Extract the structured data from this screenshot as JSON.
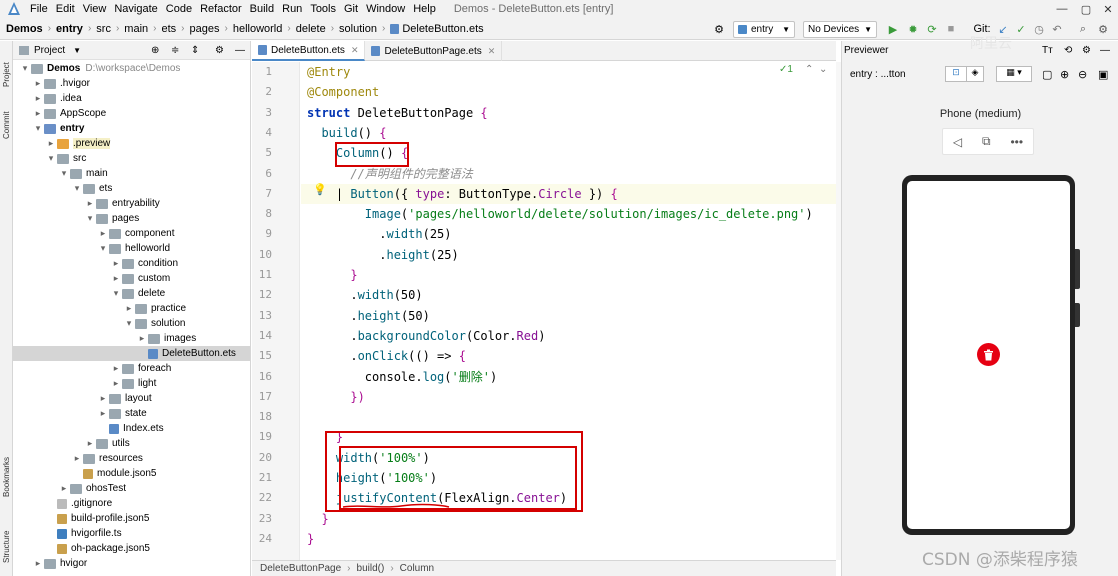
{
  "menu": {
    "items": [
      "File",
      "Edit",
      "View",
      "Navigate",
      "Code",
      "Refactor",
      "Build",
      "Run",
      "Tools",
      "Git",
      "Window",
      "Help"
    ],
    "window_title": "Demos - DeleteButton.ets [entry]"
  },
  "breadcrumbs": [
    "Demos",
    "entry",
    "src",
    "main",
    "ets",
    "pages",
    "helloworld",
    "delete",
    "solution",
    "DeleteButton.ets"
  ],
  "toolbar": {
    "run_config": "entry",
    "device": "No Devices",
    "git_label": "Git:"
  },
  "sidebar_tabs": [
    "Project",
    "Commit",
    "Bookmarks",
    "Structure"
  ],
  "project": {
    "title": "Project",
    "tree": [
      {
        "label": "Demos",
        "path": "D:\\workspace\\Demos",
        "depth": 0,
        "arrow": "▾",
        "icon": "folder",
        "bold": true
      },
      {
        "label": ".hvigor",
        "depth": 1,
        "arrow": "▸",
        "icon": "folder"
      },
      {
        "label": ".idea",
        "depth": 1,
        "arrow": "▸",
        "icon": "folder"
      },
      {
        "label": "AppScope",
        "depth": 1,
        "arrow": "▸",
        "icon": "folder"
      },
      {
        "label": "entry",
        "depth": 1,
        "arrow": "▾",
        "icon": "folder-blue",
        "bold": true
      },
      {
        "label": ".preview",
        "depth": 2,
        "arrow": "▸",
        "icon": "folder-orange",
        "highlight": true
      },
      {
        "label": "src",
        "depth": 2,
        "arrow": "▾",
        "icon": "folder"
      },
      {
        "label": "main",
        "depth": 3,
        "arrow": "▾",
        "icon": "folder"
      },
      {
        "label": "ets",
        "depth": 4,
        "arrow": "▾",
        "icon": "folder"
      },
      {
        "label": "entryability",
        "depth": 5,
        "arrow": "▸",
        "icon": "folder"
      },
      {
        "label": "pages",
        "depth": 5,
        "arrow": "▾",
        "icon": "folder"
      },
      {
        "label": "component",
        "depth": 6,
        "arrow": "▸",
        "icon": "folder"
      },
      {
        "label": "helloworld",
        "depth": 6,
        "arrow": "▾",
        "icon": "folder"
      },
      {
        "label": "condition",
        "depth": 7,
        "arrow": "▸",
        "icon": "folder"
      },
      {
        "label": "custom",
        "depth": 7,
        "arrow": "▸",
        "icon": "folder"
      },
      {
        "label": "delete",
        "depth": 7,
        "arrow": "▾",
        "icon": "folder"
      },
      {
        "label": "practice",
        "depth": 8,
        "arrow": "▸",
        "icon": "folder"
      },
      {
        "label": "solution",
        "depth": 8,
        "arrow": "▾",
        "icon": "folder"
      },
      {
        "label": "images",
        "depth": 9,
        "arrow": "▸",
        "icon": "folder"
      },
      {
        "label": "DeleteButton.ets",
        "depth": 9,
        "arrow": "",
        "icon": "ets",
        "selected": true
      },
      {
        "label": "foreach",
        "depth": 7,
        "arrow": "▸",
        "icon": "folder"
      },
      {
        "label": "light",
        "depth": 7,
        "arrow": "▸",
        "icon": "folder"
      },
      {
        "label": "layout",
        "depth": 6,
        "arrow": "▸",
        "icon": "folder"
      },
      {
        "label": "state",
        "depth": 6,
        "arrow": "▸",
        "icon": "folder"
      },
      {
        "label": "Index.ets",
        "depth": 6,
        "arrow": "",
        "icon": "ets"
      },
      {
        "label": "utils",
        "depth": 5,
        "arrow": "▸",
        "icon": "folder"
      },
      {
        "label": "resources",
        "depth": 4,
        "arrow": "▸",
        "icon": "folder"
      },
      {
        "label": "module.json5",
        "depth": 4,
        "arrow": "",
        "icon": "json"
      },
      {
        "label": "ohosTest",
        "depth": 3,
        "arrow": "▸",
        "icon": "folder"
      },
      {
        "label": ".gitignore",
        "depth": 2,
        "arrow": "",
        "icon": "git"
      },
      {
        "label": "build-profile.json5",
        "depth": 2,
        "arrow": "",
        "icon": "json"
      },
      {
        "label": "hvigorfile.ts",
        "depth": 2,
        "arrow": "",
        "icon": "ts"
      },
      {
        "label": "oh-package.json5",
        "depth": 2,
        "arrow": "",
        "icon": "json"
      },
      {
        "label": "hvigor",
        "depth": 1,
        "arrow": "▸",
        "icon": "folder"
      }
    ]
  },
  "editor": {
    "tabs": [
      {
        "label": "DeleteButton.ets",
        "active": true
      },
      {
        "label": "DeleteButtonPage.ets",
        "active": false
      }
    ],
    "inspection": "✓1",
    "line_numbers": [
      "1",
      "2",
      "3",
      "4",
      "5",
      "6",
      "7",
      "8",
      "9",
      "10",
      "11",
      "12",
      "13",
      "14",
      "15",
      "16",
      "17",
      "18",
      "19",
      "20",
      "21",
      "22",
      "23",
      "24"
    ],
    "code_lines": [
      [
        [
          "ann",
          "@Entry"
        ]
      ],
      [
        [
          "ann",
          "@Component"
        ]
      ],
      [
        [
          "kw",
          "struct "
        ],
        [
          "typ",
          "DeleteButtonPage "
        ],
        [
          "brk",
          "{"
        ]
      ],
      [
        [
          "typ",
          "  "
        ],
        [
          "fn",
          "build"
        ],
        [
          "typ",
          "() "
        ],
        [
          "brk",
          "{"
        ]
      ],
      [
        [
          "typ",
          "    "
        ],
        [
          "fn",
          "Column"
        ],
        [
          "typ",
          "() "
        ],
        [
          "brk",
          "{"
        ]
      ],
      [
        [
          "typ",
          "      "
        ],
        [
          "cmt",
          "//声明组件的完整语法"
        ]
      ],
      [
        [
          "typ",
          "    | "
        ],
        [
          "fn",
          "Button"
        ],
        [
          "typ",
          "({ "
        ],
        [
          "prop",
          "type"
        ],
        [
          "typ",
          ": ButtonType."
        ],
        [
          "prop",
          "Circle"
        ],
        [
          "typ",
          " }) "
        ],
        [
          "brk",
          "{"
        ]
      ],
      [
        [
          "typ",
          "        "
        ],
        [
          "fn",
          "Image"
        ],
        [
          "typ",
          "("
        ],
        [
          "str",
          "'pages/helloworld/delete/solution/images/ic_delete.png'"
        ],
        [
          "typ",
          ")"
        ]
      ],
      [
        [
          "typ",
          "          ."
        ],
        [
          "fn",
          "width"
        ],
        [
          "typ",
          "(25)"
        ]
      ],
      [
        [
          "typ",
          "          ."
        ],
        [
          "fn",
          "height"
        ],
        [
          "typ",
          "(25)"
        ]
      ],
      [
        [
          "typ",
          "      "
        ],
        [
          "brk",
          "}"
        ]
      ],
      [
        [
          "typ",
          "      ."
        ],
        [
          "fn",
          "width"
        ],
        [
          "typ",
          "(50)"
        ]
      ],
      [
        [
          "typ",
          "      ."
        ],
        [
          "fn",
          "height"
        ],
        [
          "typ",
          "(50)"
        ]
      ],
      [
        [
          "typ",
          "      ."
        ],
        [
          "fn",
          "backgroundColor"
        ],
        [
          "typ",
          "(Color."
        ],
        [
          "prop",
          "Red"
        ],
        [
          "typ",
          ")"
        ]
      ],
      [
        [
          "typ",
          "      ."
        ],
        [
          "fn",
          "onClick"
        ],
        [
          "typ",
          "(() => "
        ],
        [
          "brk",
          "{"
        ]
      ],
      [
        [
          "typ",
          "        console."
        ],
        [
          "fn",
          "log"
        ],
        [
          "typ",
          "("
        ],
        [
          "str",
          "'删除'"
        ],
        [
          "typ",
          ")"
        ]
      ],
      [
        [
          "typ",
          "      "
        ],
        [
          "brk",
          "})"
        ]
      ],
      [
        [
          "typ",
          ""
        ]
      ],
      [
        [
          "typ",
          "    "
        ],
        [
          "brk",
          "}"
        ]
      ],
      [
        [
          "typ",
          "    "
        ],
        [
          "fn",
          "width"
        ],
        [
          "typ",
          "("
        ],
        [
          "str",
          "'100%'"
        ],
        [
          "typ",
          ")"
        ]
      ],
      [
        [
          "typ",
          "    "
        ],
        [
          "fn",
          "height"
        ],
        [
          "typ",
          "("
        ],
        [
          "str",
          "'100%'"
        ],
        [
          "typ",
          ")"
        ]
      ],
      [
        [
          "typ",
          "    "
        ],
        [
          "fn",
          "justifyContent"
        ],
        [
          "typ",
          "(FlexAlign."
        ],
        [
          "prop",
          "Center"
        ],
        [
          "typ",
          ")"
        ]
      ],
      [
        [
          "typ",
          "  "
        ],
        [
          "brk",
          "}"
        ]
      ],
      [
        [
          "brk",
          "}"
        ]
      ]
    ]
  },
  "status": {
    "crumbs": [
      "DeleteButtonPage",
      "build()",
      "Column"
    ]
  },
  "previewer": {
    "title": "Previewer",
    "target": "entry : ...tton",
    "device_label": "Phone (medium)"
  },
  "watermark": "CSDN @添柴程序猿",
  "watermark_top": "阿里云"
}
